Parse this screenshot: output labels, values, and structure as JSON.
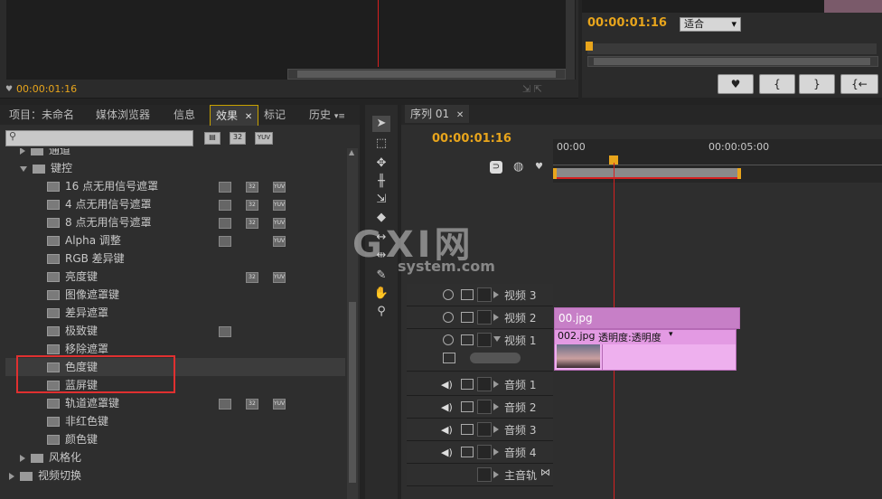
{
  "source_monitor": {
    "timecode": "00:00:01:16"
  },
  "program_monitor": {
    "timecode": "00:00:01:16",
    "zoom_select": "适合",
    "buttons": {
      "marker": "♥",
      "in": "{",
      "out": "}",
      "goto_in": "{←"
    }
  },
  "effects_panel": {
    "tabs": [
      "项目：未命名",
      "媒体浏览器",
      "信息",
      "效果",
      "标记",
      "历史"
    ],
    "active_tab": "效果",
    "search_placeholder": "",
    "filter_badges": [
      "32",
      "YUV"
    ],
    "items": [
      {
        "label": "通道",
        "type": "folder",
        "level": 1,
        "expanded": false
      },
      {
        "label": "键控",
        "type": "folder",
        "level": 1,
        "expanded": true
      },
      {
        "label": "16 点无用信号遮罩",
        "type": "effect",
        "level": 2,
        "badges": [
          "accel",
          "32",
          "YUV"
        ]
      },
      {
        "label": "4 点无用信号遮罩",
        "type": "effect",
        "level": 2,
        "badges": [
          "accel",
          "32",
          "YUV"
        ]
      },
      {
        "label": "8 点无用信号遮罩",
        "type": "effect",
        "level": 2,
        "badges": [
          "accel",
          "32",
          "YUV"
        ]
      },
      {
        "label": "Alpha 调整",
        "type": "effect",
        "level": 2,
        "badges": [
          "accel",
          "",
          "YUV"
        ]
      },
      {
        "label": "RGB 差异键",
        "type": "effect",
        "level": 2,
        "badges": []
      },
      {
        "label": "亮度键",
        "type": "effect",
        "level": 2,
        "badges": [
          "",
          "32",
          "YUV"
        ]
      },
      {
        "label": "图像遮罩键",
        "type": "effect",
        "level": 2,
        "badges": []
      },
      {
        "label": "差异遮罩",
        "type": "effect",
        "level": 2,
        "badges": []
      },
      {
        "label": "极致键",
        "type": "effect",
        "level": 2,
        "badges": [
          "accel",
          "",
          ""
        ]
      },
      {
        "label": "移除遮罩",
        "type": "effect",
        "level": 2,
        "badges": []
      },
      {
        "label": "色度键",
        "type": "effect",
        "level": 2,
        "badges": [],
        "highlighted": true
      },
      {
        "label": "蓝屏键",
        "type": "effect",
        "level": 2,
        "badges": []
      },
      {
        "label": "轨道遮罩键",
        "type": "effect",
        "level": 2,
        "badges": [
          "accel",
          "32",
          "YUV"
        ]
      },
      {
        "label": "非红色键",
        "type": "effect",
        "level": 2,
        "badges": []
      },
      {
        "label": "颜色键",
        "type": "effect",
        "level": 2,
        "badges": []
      },
      {
        "label": "风格化",
        "type": "folder",
        "level": 1,
        "expanded": false
      },
      {
        "label": "视频切换",
        "type": "folder",
        "level": 0,
        "expanded": false
      }
    ]
  },
  "timeline": {
    "tab": "序列 01",
    "timecode": "00:00:01:16",
    "ruler": [
      "00:00",
      "00:00:05:00"
    ],
    "tracks": [
      {
        "label": "视频 3",
        "kind": "video"
      },
      {
        "label": "视频 2",
        "kind": "video"
      },
      {
        "label": "视频 1",
        "kind": "video"
      },
      {
        "label": "音频 1",
        "kind": "audio"
      },
      {
        "label": "音频 2",
        "kind": "audio"
      },
      {
        "label": "音频 3",
        "kind": "audio"
      },
      {
        "label": "音频 4",
        "kind": "audio"
      },
      {
        "label": "主音轨",
        "kind": "master"
      }
    ],
    "clips": {
      "v2": "00.jpg",
      "v1_name": "002.jpg",
      "v1_property": "透明度:透明度"
    }
  },
  "watermark": {
    "line1": "GXI网",
    "line2": "system.com"
  },
  "colors": {
    "accent": "#e8a51c",
    "clip": "#d891d8",
    "highlight": "#e03030",
    "playhead": "#d62020"
  }
}
